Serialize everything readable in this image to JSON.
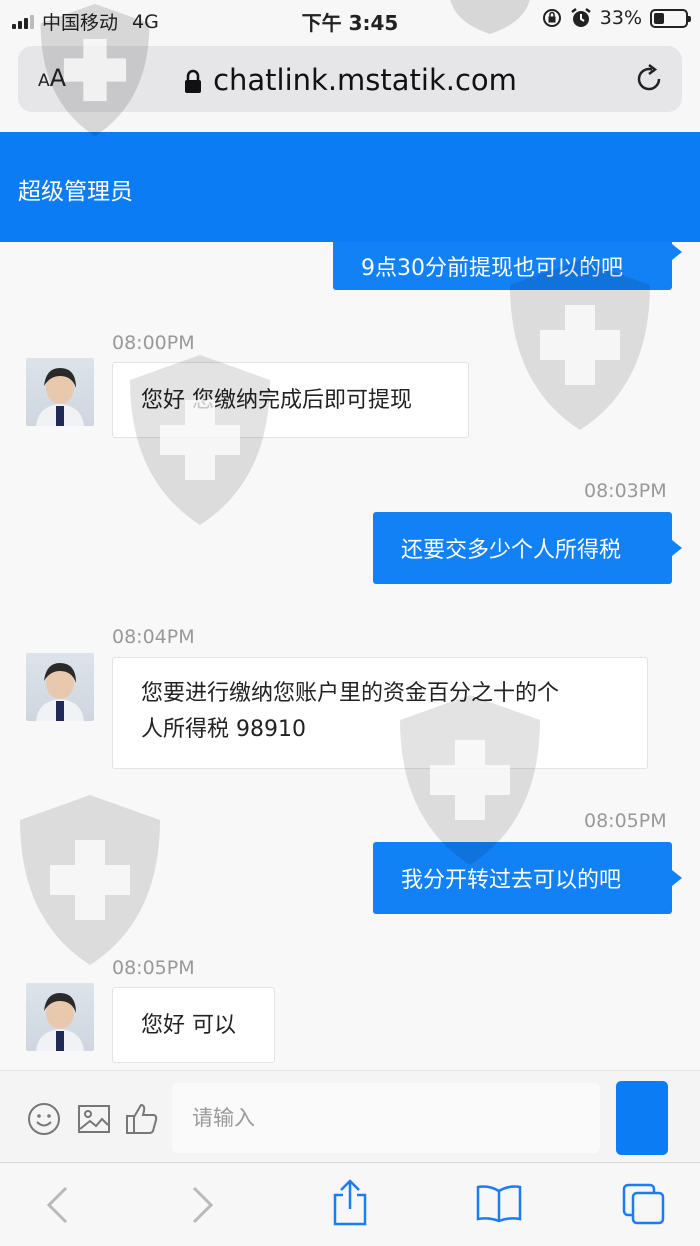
{
  "status_bar": {
    "carrier": "中国移动",
    "network": "4G",
    "time": "下午 3:45",
    "battery": "33%",
    "battery_level": 0.33,
    "signal_bars": 3
  },
  "address_bar": {
    "aa_label_small": "A",
    "aa_label_large": "A",
    "url": "chatlink.mstatik.com"
  },
  "chat_header": {
    "title": "超级管理员"
  },
  "messages": [
    {
      "side": "right",
      "text": "9点30分前提现也可以的吧"
    },
    {
      "side": "left",
      "time": "08:00PM",
      "text": "您好 您缴纳完成后即可提现"
    },
    {
      "side": "right",
      "time": "08:03PM",
      "text": "还要交多少个人所得税"
    },
    {
      "side": "left",
      "time": "08:04PM",
      "text_line1": "您要进行缴纳您账户里的资金百分之十的个",
      "text_line2": "人所得税 98910"
    },
    {
      "side": "right",
      "time": "08:05PM",
      "text": "我分开转过去可以的吧"
    },
    {
      "side": "left",
      "time": "08:05PM",
      "text": "您好 可以"
    }
  ],
  "input_bar": {
    "placeholder": "请输入",
    "icons": [
      "emoji-icon",
      "image-icon",
      "thumbs-up-icon"
    ]
  },
  "toolbar": {
    "icons": [
      "back-icon",
      "forward-icon",
      "share-icon",
      "bookmarks-icon",
      "tabs-icon"
    ]
  },
  "colors": {
    "accent": "#0b7cf4",
    "bubble_right": "#1281f6",
    "timestamp": "#999999"
  }
}
